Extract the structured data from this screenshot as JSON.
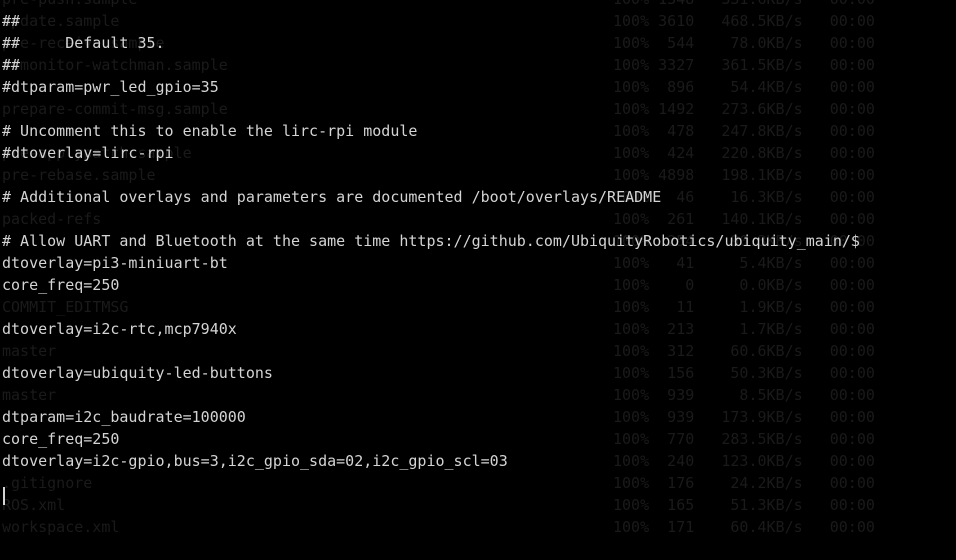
{
  "editor": {
    "lines": [
      "",
      "##",
      "##     Default 35.",
      "##",
      "#dtparam=pwr_led_gpio=35",
      "",
      "# Uncomment this to enable the lirc-rpi module",
      "#dtoverlay=lirc-rpi",
      "",
      "# Additional overlays and parameters are documented /boot/overlays/README",
      "",
      "# Allow UART and Bluetooth at the same time https://github.com/UbiquityRobotics/ubiquity_main/$",
      "dtoverlay=pi3-miniuart-bt",
      "core_freq=250",
      "",
      "dtoverlay=i2c-rtc,mcp7940x",
      "",
      "dtoverlay=ubiquity-led-buttons",
      "",
      "dtparam=i2c_baudrate=100000",
      "core_freq=250",
      "dtoverlay=i2c-gpio,bus=3,i2c_gpio_sda=02,i2c_gpio_scl=03",
      "",
      "",
      "",
      ""
    ]
  },
  "background_transfer": {
    "rows": [
      {
        "name": "pre-push.sample",
        "stats": "100% 1348   331.6KB/s   00:00"
      },
      {
        "name": "update.sample",
        "stats": "100% 3610   468.5KB/s   00:00"
      },
      {
        "name": "pre-receive.sample",
        "stats": "100%  544    78.0KB/s   00:00"
      },
      {
        "name": "fsmonitor-watchman.sample",
        "stats": "100% 3327   361.5KB/s   00:00"
      },
      {
        "name": "",
        "stats": "100%  896    54.4KB/s   00:00"
      },
      {
        "name": "prepare-commit-msg.sample",
        "stats": "100% 1492   273.6KB/s   00:00"
      },
      {
        "name": "",
        "stats": "100%  478   247.8KB/s   00:00"
      },
      {
        "name": "pre-applypatch.sample",
        "stats": "100%  424   220.8KB/s   00:00"
      },
      {
        "name": "pre-rebase.sample",
        "stats": "100% 4898   198.1KB/s   00:00"
      },
      {
        "name": "",
        "stats": "100%   46    16.3KB/s   00:00"
      },
      {
        "name": "packed-refs",
        "stats": "100%  261   140.1KB/s   00:00"
      },
      {
        "name": "",
        "stats": "100%  254    90.3KB/s   00:00"
      },
      {
        "name": "",
        "stats": "100%   41     5.4KB/s   00:00"
      },
      {
        "name": "",
        "stats": "100%    0     0.0KB/s   00:00"
      },
      {
        "name": "COMMIT_EDITMSG",
        "stats": "100%   11     1.9KB/s   00:00"
      },
      {
        "name": "",
        "stats": "100%  213     1.7KB/s   00:00"
      },
      {
        "name": "master",
        "stats": "100%  312    60.6KB/s   00:00"
      },
      {
        "name": "",
        "stats": "100%  156    50.3KB/s   00:00"
      },
      {
        "name": "master",
        "stats": "100%  939     8.5KB/s   00:00"
      },
      {
        "name": "",
        "stats": "100%  939   173.9KB/s   00:00"
      },
      {
        "name": "",
        "stats": "100%  770   283.5KB/s   00:00"
      },
      {
        "name": "",
        "stats": "100%  240   123.0KB/s   00:00"
      },
      {
        "name": ".gitignore",
        "stats": "100%  176    24.2KB/s   00:00"
      },
      {
        "name": "ROS.xml",
        "stats": "100%  165    51.3KB/s   00:00"
      },
      {
        "name": "workspace.xml",
        "stats": "100%  171    60.4KB/s   00:00"
      },
      {
        "name": "",
        "stats": ""
      }
    ]
  },
  "colors": {
    "background": "#000000",
    "foreground": "#d4d4d4",
    "faded_text": "#1a1a1a"
  }
}
